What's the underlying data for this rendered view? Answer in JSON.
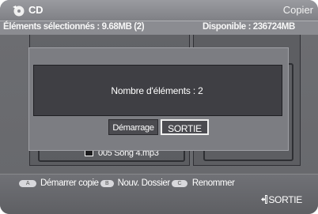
{
  "header": {
    "title": "CD",
    "right_label": "Copier",
    "icon": "disc-icon"
  },
  "info": {
    "selected": "Éléments sélectionnés : 9.68MB  (2)",
    "available": "Disponible : 236724MB"
  },
  "file_list": {
    "items": [
      {
        "label": "005 Song 4.mp3",
        "checked": false
      }
    ]
  },
  "dialog": {
    "message": "Nombre d'éléments : 2",
    "start_label": "Démarrage",
    "exit_label": "SORTIE"
  },
  "footer": {
    "keys": [
      {
        "key": "A",
        "label": "Démarrer copie"
      },
      {
        "key": "B",
        "label": "Nouv. Dossier"
      },
      {
        "key": "C",
        "label": "Renommer"
      }
    ],
    "exit_label": "SORTIE",
    "exit_icon": "exit-icon"
  }
}
